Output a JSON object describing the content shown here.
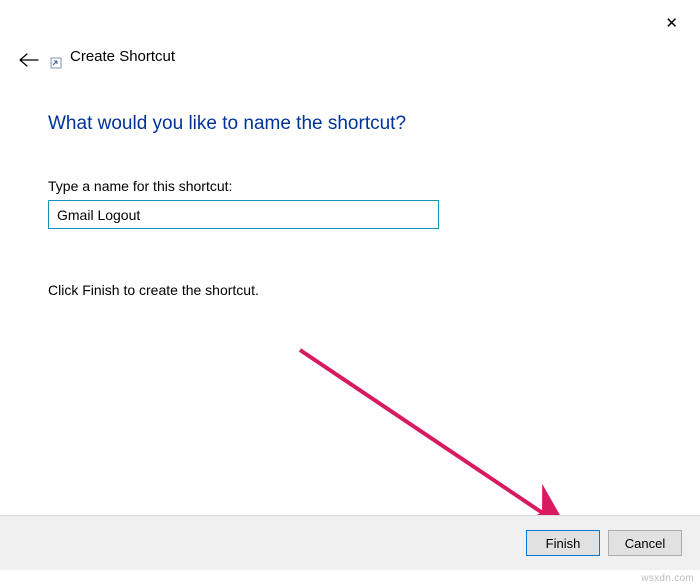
{
  "window": {
    "title": "Create Shortcut"
  },
  "heading": "What would you like to name the shortcut?",
  "input": {
    "label": "Type a name for this shortcut:",
    "value": "Gmail Logout"
  },
  "instruction": "Click Finish to create the shortcut.",
  "buttons": {
    "finish": "Finish",
    "cancel": "Cancel"
  },
  "watermark": "wsxdn.com",
  "colors": {
    "heading": "#003399",
    "input_border": "#1296b5",
    "primary_border": "#0078d7",
    "arrow": "#d81b60"
  }
}
